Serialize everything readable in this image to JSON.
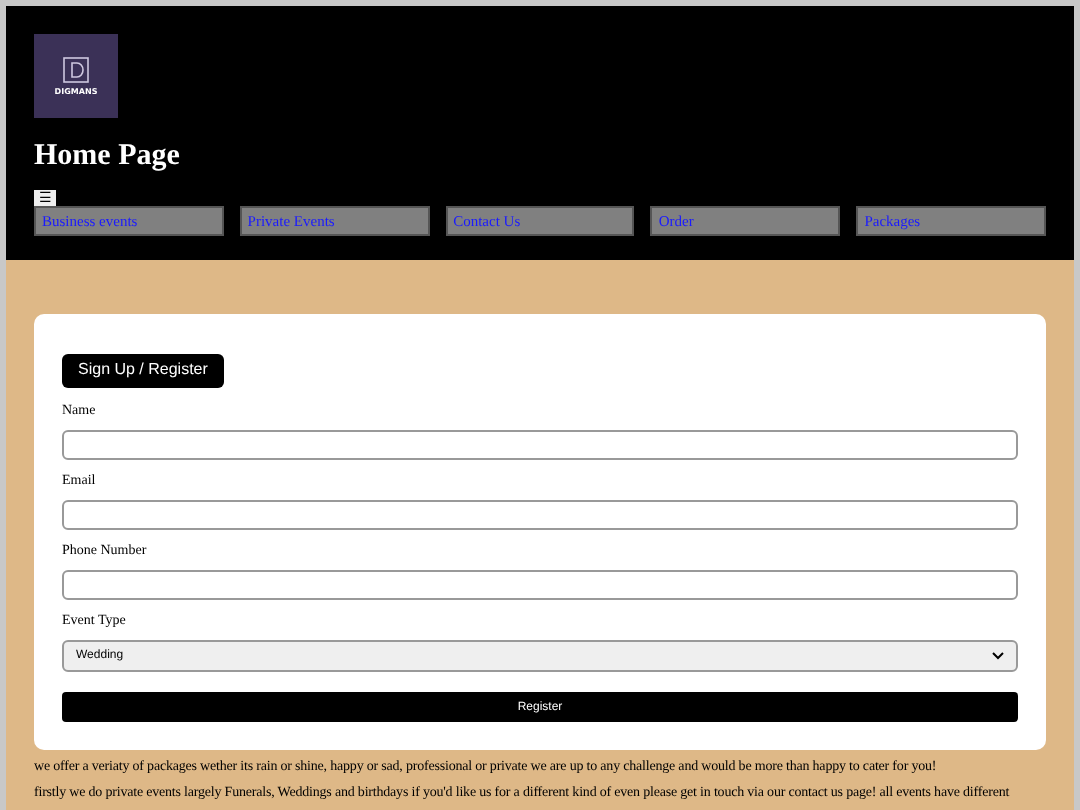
{
  "header": {
    "logo_text": "DIGMANS",
    "title": "Home Page",
    "menu_icon": "☰",
    "nav": [
      {
        "label": "Business events"
      },
      {
        "label": "Private Events"
      },
      {
        "label": "Contact Us"
      },
      {
        "label": "Order"
      },
      {
        "label": "Packages"
      }
    ]
  },
  "form": {
    "tab": "Sign Up / Register",
    "fields": [
      {
        "kind": "text",
        "label": "Name"
      },
      {
        "kind": "text",
        "label": "Email"
      },
      {
        "kind": "text",
        "label": "Phone Number"
      },
      {
        "kind": "select",
        "label": "Event Type",
        "value": "Wedding"
      }
    ],
    "submit": "Register"
  },
  "paragraphs": [
    "we offer a veriaty of packages wether its rain or shine, happy or sad, professional or private we are up to any challenge and would be more than happy to cater for you!",
    "firstly we do private events largely Funerals, Weddings and birthdays if you'd like us for a different kind of even please get in touch via our contact us page! all events have different"
  ]
}
